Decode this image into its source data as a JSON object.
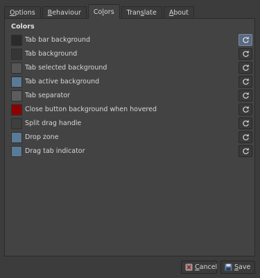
{
  "tabs": [
    {
      "label": "Options",
      "mnemonic": "O",
      "rest": "ptions"
    },
    {
      "label": "Behaviour",
      "mnemonic": "B",
      "rest": "ehaviour"
    },
    {
      "label": "Colors",
      "pre": "Co",
      "mnemonic": "l",
      "rest": "ors",
      "active": true
    },
    {
      "label": "Translate",
      "pre": "Tran",
      "mnemonic": "s",
      "rest": "late"
    },
    {
      "label": "About",
      "mnemonic": "A",
      "rest": "bout"
    }
  ],
  "colors": {
    "title": "Colors",
    "rows": [
      {
        "label": "Tab bar background",
        "swatch": "#2b2b2b"
      },
      {
        "label": "Tab background",
        "swatch": "#363636"
      },
      {
        "label": "Tab selected background",
        "swatch": "#565656"
      },
      {
        "label": "Tab active background",
        "swatch": "#5a7a98"
      },
      {
        "label": "Tab separator",
        "swatch": "#5c5c5c"
      },
      {
        "label": "Close button background when hovered",
        "swatch": "#8e0000"
      },
      {
        "label": "Split drag handle",
        "swatch": "#3e3e3e"
      },
      {
        "label": "Drop zone",
        "swatch": "#5a7a98"
      },
      {
        "label": "Drag tab indicator",
        "swatch": "#5a7a98"
      }
    ]
  },
  "buttons": {
    "cancel": {
      "mnemonic": "C",
      "rest": "ancel",
      "label": "Cancel"
    },
    "save": {
      "mnemonic": "S",
      "rest": "ave",
      "label": "Save"
    }
  }
}
